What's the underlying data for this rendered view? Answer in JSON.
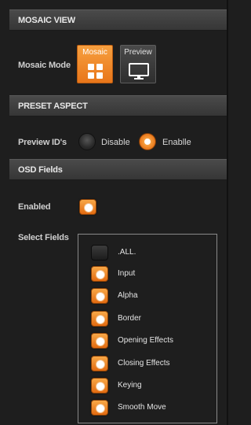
{
  "sections": {
    "mosaic_view": "MOSAIC VIEW",
    "preset_aspect": "PRESET ASPECT",
    "osd_fields": "OSD Fields"
  },
  "mosaic_mode": {
    "label": "Mosaic Mode",
    "options": [
      "Mosaic",
      "Preview"
    ],
    "selected": "Mosaic"
  },
  "preview_ids": {
    "label": "Preview ID's",
    "options": [
      "Disable",
      "Enablle"
    ],
    "selected": "Enablle"
  },
  "osd": {
    "enabled_label": "Enabled",
    "enabled": true,
    "select_fields_label": "Select Fields",
    "fields": [
      {
        "label": ".ALL.",
        "checked": false
      },
      {
        "label": "Input",
        "checked": true
      },
      {
        "label": "Alpha",
        "checked": true
      },
      {
        "label": "Border",
        "checked": true
      },
      {
        "label": "Opening Effects",
        "checked": true
      },
      {
        "label": "Closing Effects",
        "checked": true
      },
      {
        "label": "Keying",
        "checked": true
      },
      {
        "label": "Smooth Move",
        "checked": true
      }
    ]
  },
  "colors": {
    "accent": "#e8761a",
    "background": "#1e1e1e",
    "header": "#3e3e3e"
  },
  "icons": {
    "mosaic": "grid-icon",
    "preview": "monitor-icon"
  }
}
